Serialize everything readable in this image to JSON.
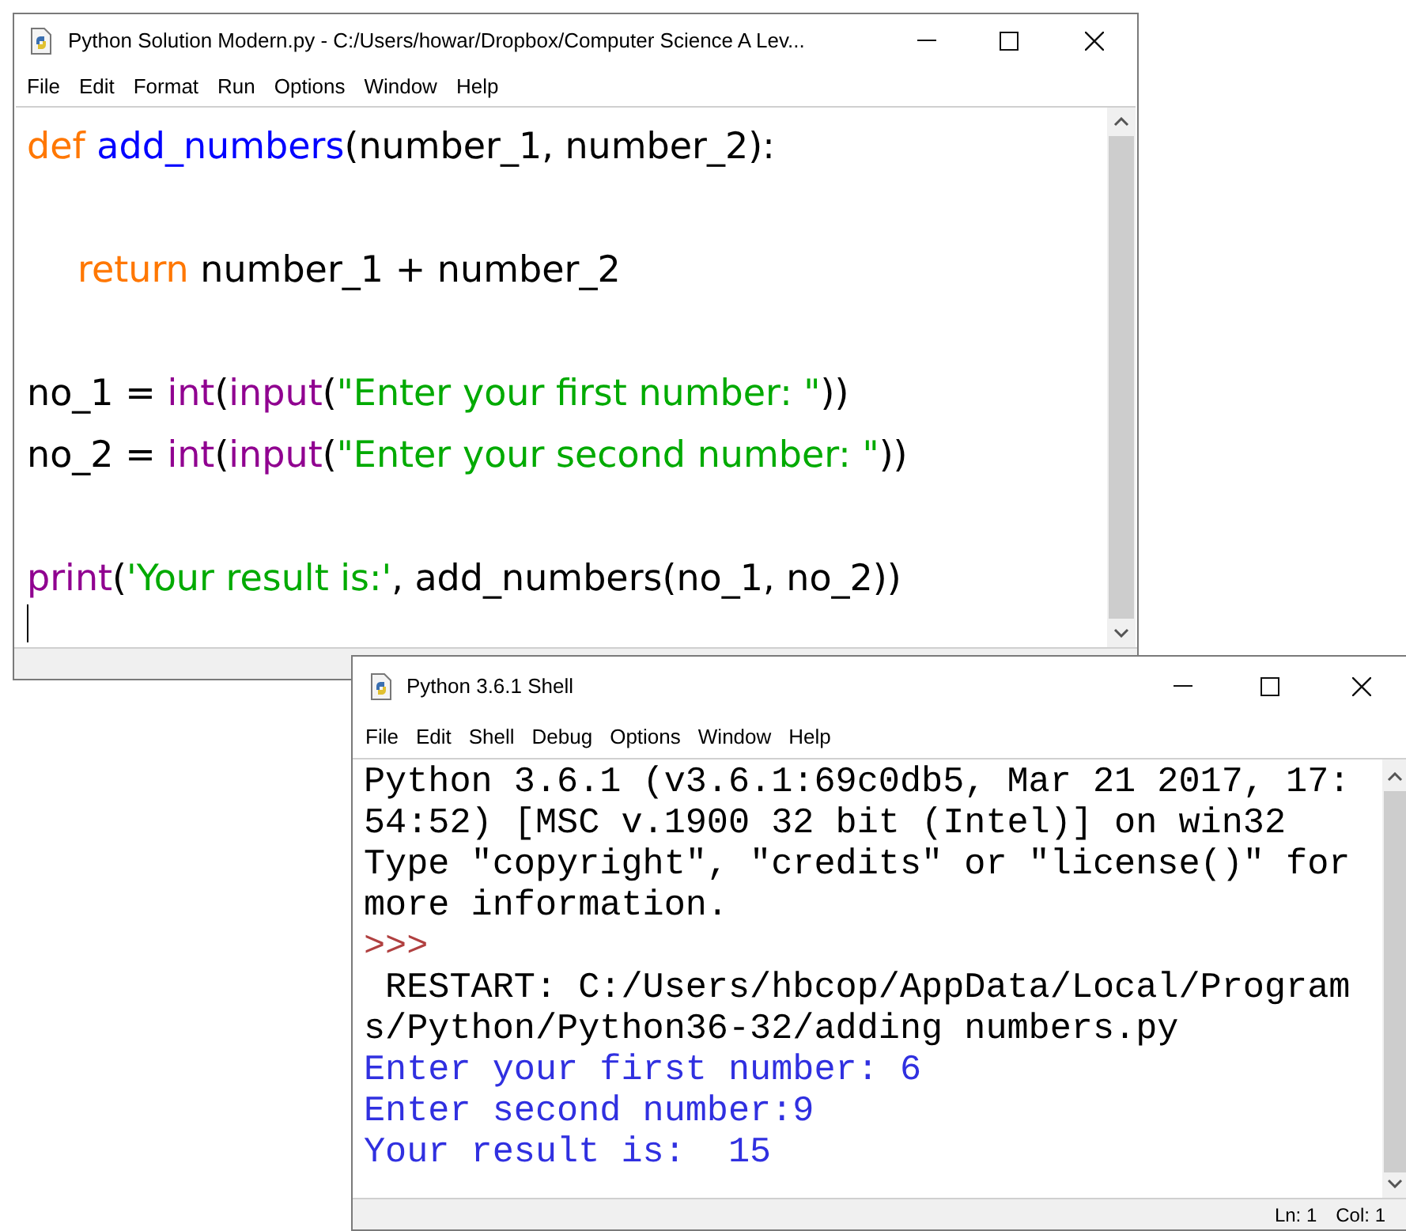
{
  "editor_window": {
    "title": "Python Solution Modern.py - C:/Users/howar/Dropbox/Computer Science A Lev...",
    "menu": [
      "File",
      "Edit",
      "Format",
      "Run",
      "Options",
      "Window",
      "Help"
    ],
    "code_lines": [
      {
        "indent": false,
        "tokens": [
          {
            "kind": "keyword",
            "text": "def "
          },
          {
            "kind": "defname",
            "text": "add_numbers"
          },
          {
            "kind": "plain",
            "text": "(number_1, number_2):"
          }
        ]
      },
      {
        "indent": true,
        "blank_line_before": true,
        "tokens": [
          {
            "kind": "keyword",
            "text": "return"
          },
          {
            "kind": "plain",
            "text": " number_1 + number_2"
          }
        ]
      },
      {
        "indent": false,
        "blank_line_before": true,
        "tokens": [
          {
            "kind": "plain",
            "text": "no_1 = "
          },
          {
            "kind": "builtin",
            "text": "int"
          },
          {
            "kind": "plain",
            "text": "("
          },
          {
            "kind": "builtin",
            "text": "input"
          },
          {
            "kind": "plain",
            "text": "("
          },
          {
            "kind": "string",
            "text": "\"Enter your first number: \""
          },
          {
            "kind": "plain",
            "text": "))"
          }
        ]
      },
      {
        "indent": false,
        "tokens": [
          {
            "kind": "plain",
            "text": "no_2 = "
          },
          {
            "kind": "builtin",
            "text": "int"
          },
          {
            "kind": "plain",
            "text": "("
          },
          {
            "kind": "builtin",
            "text": "input"
          },
          {
            "kind": "plain",
            "text": "("
          },
          {
            "kind": "string",
            "text": "\"Enter your second number: \""
          },
          {
            "kind": "plain",
            "text": "))"
          }
        ]
      },
      {
        "indent": false,
        "blank_line_before": true,
        "tokens": [
          {
            "kind": "builtin",
            "text": "print"
          },
          {
            "kind": "plain",
            "text": "("
          },
          {
            "kind": "string",
            "text": "'Your result is:'"
          },
          {
            "kind": "plain",
            "text": ", add_numbers(no_1, no_2))"
          }
        ]
      }
    ]
  },
  "shell_window": {
    "title": "Python 3.6.1 Shell",
    "menu": [
      "File",
      "Edit",
      "Shell",
      "Debug",
      "Options",
      "Window",
      "Help"
    ],
    "lines": [
      {
        "kind": "output",
        "text": "Python 3.6.1 (v3.6.1:69c0db5, Mar 21 2017, 17:"
      },
      {
        "kind": "output",
        "text": "54:52) [MSC v.1900 32 bit (Intel)] on win32"
      },
      {
        "kind": "output",
        "text": "Type \"copyright\", \"credits\" or \"license()\" for"
      },
      {
        "kind": "output",
        "text": "more information."
      },
      {
        "kind": "prompt",
        "text": ">>>"
      },
      {
        "kind": "output",
        "text": " RESTART: C:/Users/hbcop/AppData/Local/Program"
      },
      {
        "kind": "output",
        "text": "s/Python/Python36-32/adding numbers.py"
      },
      {
        "kind": "stdout",
        "text": "Enter your first number: 6"
      },
      {
        "kind": "stdout",
        "text": "Enter second number:9"
      },
      {
        "kind": "stdout",
        "text": "Your result is:  15"
      }
    ],
    "status_bar": {
      "line": "Ln: 1",
      "column": "Col: 1"
    }
  }
}
